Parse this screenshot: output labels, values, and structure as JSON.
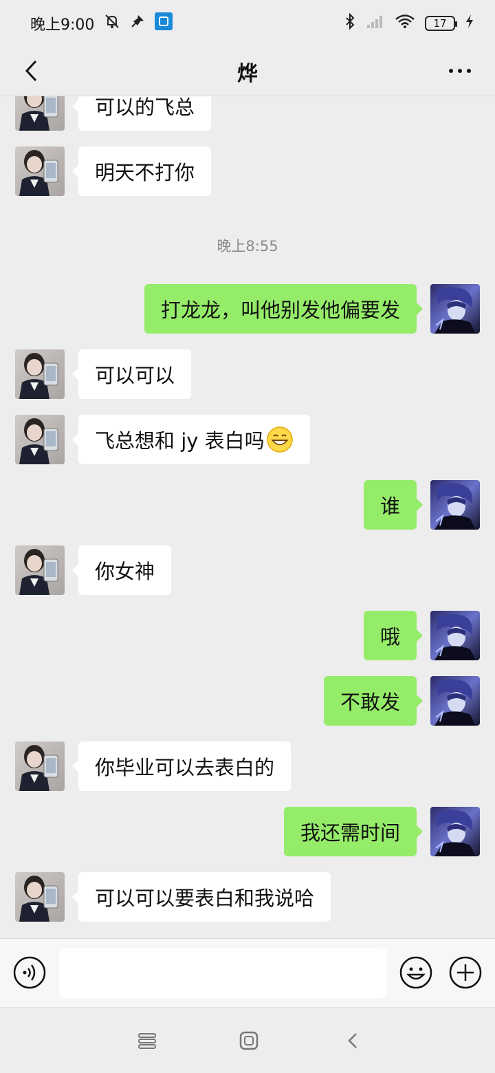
{
  "status_bar": {
    "time": "晚上9:00",
    "battery": "17",
    "icons": [
      "mute-alarm-icon",
      "pin-icon",
      "app-notification-icon",
      "bluetooth-icon",
      "signal-icon",
      "wifi-icon",
      "battery-icon",
      "charging-icon"
    ]
  },
  "header": {
    "title": "烨",
    "back_icon": "chevron-left-icon",
    "more_icon": "more-dots-icon"
  },
  "messages": [
    {
      "sender": "other",
      "text": "可以的飞总"
    },
    {
      "sender": "other",
      "text": "明天不打你"
    },
    {
      "type": "time",
      "text": "晚上8:55"
    },
    {
      "sender": "me",
      "text": "打龙龙，叫他别发他偏要发"
    },
    {
      "sender": "other",
      "text": "可以可以"
    },
    {
      "sender": "other",
      "text": "飞总想和 jy 表白吗",
      "emoji": "grinning-emoji"
    },
    {
      "sender": "me",
      "text": "谁"
    },
    {
      "sender": "other",
      "text": "你女神"
    },
    {
      "sender": "me",
      "text": "哦"
    },
    {
      "sender": "me",
      "text": "不敢发"
    },
    {
      "sender": "other",
      "text": "你毕业可以去表白的"
    },
    {
      "sender": "me",
      "text": "我还需时间"
    },
    {
      "sender": "other",
      "text": "可以可以要表白和我说哈"
    }
  ],
  "input_bar": {
    "value": "",
    "voice_icon": "voice-icon",
    "emoji_icon": "emoji-icon",
    "plus_icon": "plus-icon"
  },
  "colors": {
    "background": "#ededed",
    "my_bubble": "#95ec69",
    "other_bubble": "#ffffff"
  },
  "system_nav": {
    "icons": [
      "menu-icon",
      "home-icon",
      "back-icon"
    ]
  }
}
